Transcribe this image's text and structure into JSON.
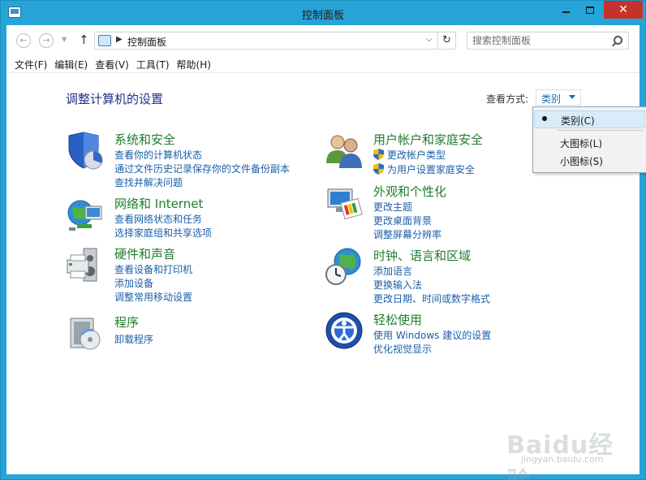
{
  "window": {
    "title": "控制面板"
  },
  "nav": {
    "address": "控制面板",
    "search_placeholder": "搜索控制面板"
  },
  "menu": [
    {
      "label": "文件(F)"
    },
    {
      "label": "编辑(E)"
    },
    {
      "label": "查看(V)"
    },
    {
      "label": "工具(T)"
    },
    {
      "label": "帮助(H)"
    }
  ],
  "heading": "调整计算机的设置",
  "view_by": {
    "label": "查看方式:",
    "selected": "类别",
    "options": [
      "类别(C)",
      "大图标(L)",
      "小图标(S)"
    ]
  },
  "categories": {
    "system": {
      "title": "系统和安全",
      "icon": "shield-pie-icon",
      "links": [
        "查看你的计算机状态",
        "通过文件历史记录保存你的文件备份副本",
        "查找并解决问题"
      ]
    },
    "network": {
      "title": "网络和 Internet",
      "icon": "globe-network-icon",
      "links": [
        "查看网络状态和任务",
        "选择家庭组和共享选项"
      ]
    },
    "hardware": {
      "title": "硬件和声音",
      "icon": "printer-speaker-icon",
      "links": [
        "查看设备和打印机",
        "添加设备",
        "调整常用移动设置"
      ]
    },
    "programs": {
      "title": "程序",
      "icon": "programs-icon",
      "links": [
        "卸载程序"
      ]
    },
    "users": {
      "title": "用户帐户和家庭安全",
      "icon": "users-icon",
      "links": [
        "更改帐户类型",
        "为用户设置家庭安全"
      ]
    },
    "appearance": {
      "title": "外观和个性化",
      "icon": "monitor-palette-icon",
      "links": [
        "更改主题",
        "更改桌面背景",
        "调整屏幕分辨率"
      ]
    },
    "clock": {
      "title": "时钟、语言和区域",
      "icon": "globe-clock-icon",
      "links": [
        "添加语言",
        "更换输入法",
        "更改日期、时间或数字格式"
      ]
    },
    "ease": {
      "title": "轻松使用",
      "icon": "ease-of-access-icon",
      "links": [
        "使用 Windows 建议的设置",
        "优化视觉显示"
      ]
    }
  },
  "watermark": {
    "text": "Baidu经验",
    "sub": "jingyan.baidu.com"
  }
}
